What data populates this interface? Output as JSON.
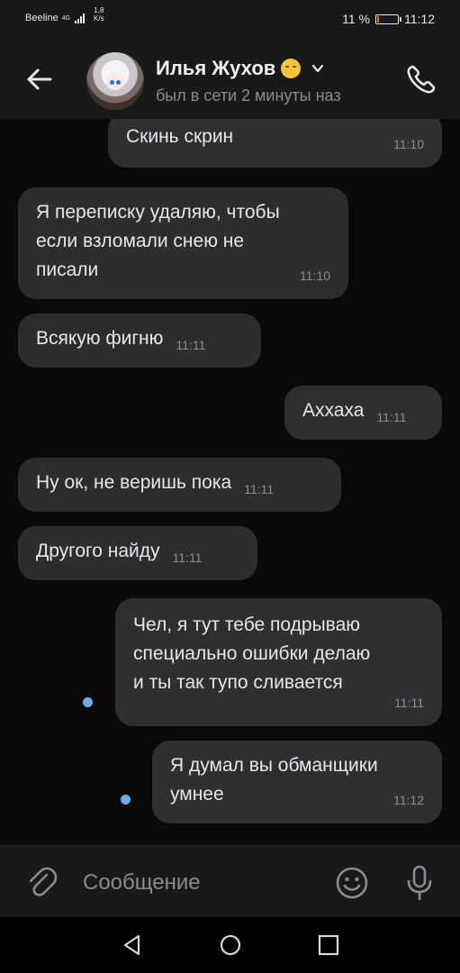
{
  "status_bar": {
    "carrier": "Beeline",
    "network": "4G",
    "speed_value": "1,8",
    "speed_unit": "K/s",
    "battery_percent": "11 %",
    "battery_level": 0.11,
    "battery_accent": "#f06a1f",
    "time": "11:12"
  },
  "header": {
    "back_icon": "arrow-left-icon",
    "contact_name": "Илья Жухов",
    "status_emoji": "sneezing-face-emoji",
    "last_seen": "был в сети 2 минуты наз",
    "call_icon": "phone-icon"
  },
  "messages": [
    {
      "direction": "out",
      "text": "Скинь скрин",
      "time": "11:10"
    },
    {
      "direction": "in",
      "text": "Я переписку удаляю, чтобы\nесли взломали снею не\nписали",
      "time": "11:10"
    },
    {
      "direction": "in",
      "text": "Всякую фигню",
      "time": "11:11"
    },
    {
      "direction": "out",
      "text": "Аххаха",
      "time": "11:11"
    },
    {
      "direction": "in",
      "text": "Ну ок, не веришь пока",
      "time": "11:11"
    },
    {
      "direction": "in",
      "text": "Другого найду",
      "time": "11:11"
    },
    {
      "direction": "out",
      "text": "Чел, я тут тебе подрываю\nспециально ошибки делаю\nи ты так тупо сливается",
      "time": "11:11",
      "unread": true
    },
    {
      "direction": "out",
      "text": "Я думал вы обманщики\nумнее",
      "time": "11:12",
      "unread": true
    }
  ],
  "composer": {
    "attach_icon": "paperclip-icon",
    "placeholder": "Сообщение",
    "emoji_icon": "smiley-icon",
    "voice_icon": "microphone-icon"
  },
  "nav_bar": {
    "back": "triangle-back-icon",
    "home": "circle-home-icon",
    "recents": "square-recents-icon"
  },
  "colors": {
    "background": "#0a0a0a",
    "bubble": "#2c2d2e",
    "bar": "#19191a",
    "unread_dot": "#71aaeb",
    "secondary_text": "#8a8c90"
  }
}
